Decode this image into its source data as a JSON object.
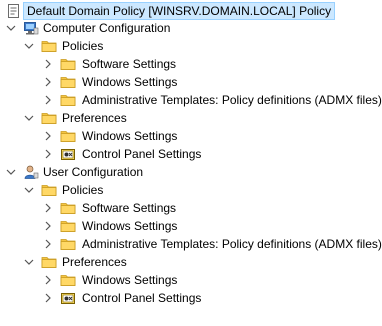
{
  "tree": {
    "root": "Default Domain Policy [WINSRV.DOMAIN.LOCAL] Policy",
    "computer": {
      "label": "Computer Configuration",
      "policies": {
        "label": "Policies",
        "software": "Software Settings",
        "windows": "Windows Settings",
        "admin": "Administrative Templates: Policy definitions (ADMX files)"
      },
      "preferences": {
        "label": "Preferences",
        "windows": "Windows Settings",
        "control_panel": "Control Panel Settings"
      }
    },
    "user": {
      "label": "User Configuration",
      "policies": {
        "label": "Policies",
        "software": "Software Settings",
        "windows": "Windows Settings",
        "admin": "Administrative Templates: Policy definitions (ADMX files)"
      },
      "preferences": {
        "label": "Preferences",
        "windows": "Windows Settings",
        "control_panel": "Control Panel Settings"
      }
    }
  },
  "colors": {
    "selection": "#cce8ff",
    "selection_border": "#99d1ff",
    "folder": "#f5c542",
    "chevron": "#555555"
  },
  "icons": {
    "root": "policy-scroll-icon",
    "computer": "computer-config-icon",
    "user": "user-config-icon",
    "folder": "folder-icon",
    "control_panel": "control-panel-icon"
  }
}
